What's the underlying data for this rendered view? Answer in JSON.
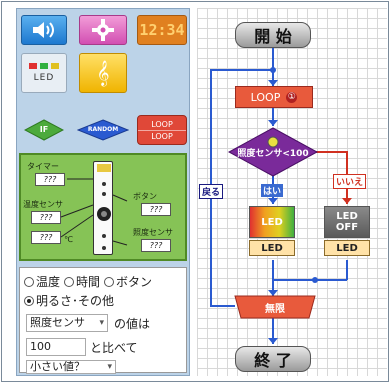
{
  "palette": {
    "clock_text": "12:34",
    "led_label": "LED",
    "music_symbol": "𝄞",
    "if_label": "IF",
    "random_label": "RANDOM",
    "loop_label_top": "LOOP",
    "loop_label_bottom": "LOOP"
  },
  "sensors": {
    "timer_label": "タイマー",
    "timer_value": "???",
    "temp_label": "温度センサ",
    "temp_value1": "???",
    "temp_value2": "???",
    "temp_unit": "℃",
    "button_label": "ボタン",
    "button_value": "???",
    "light_label": "照度センサ",
    "light_value": "???"
  },
  "settings": {
    "radio_temp": "温度",
    "radio_time": "時間",
    "radio_button": "ボタン",
    "radio_brightness": "明るさ･その他",
    "sensor_select": "照度センサ",
    "value_is": "の値は",
    "compare_value": "100",
    "compare_with": "と比べて",
    "condition_select": "小さい値？"
  },
  "flow": {
    "start_label": "開 始",
    "loop_label": "LOOP",
    "condition_label": "照度センサ<100",
    "yes_label": "はい",
    "no_label": "いいえ",
    "back_label": "戻る",
    "led_on_text": "LED",
    "led_off_text_1": "LED",
    "led_off_text_2": "OFF",
    "led_left_label": "LED",
    "led_right_label": "LED",
    "infinite_label": "無限",
    "end_label": "終 了"
  },
  "colors": {
    "canvas_bg": "#ffffff",
    "palette_bg": "#bcd3e8",
    "sensor_panel": "#86c356",
    "loop_red": "#e85a3c",
    "condition_purple": "#7a2a9a",
    "connector_blue": "#2a5ad0"
  }
}
